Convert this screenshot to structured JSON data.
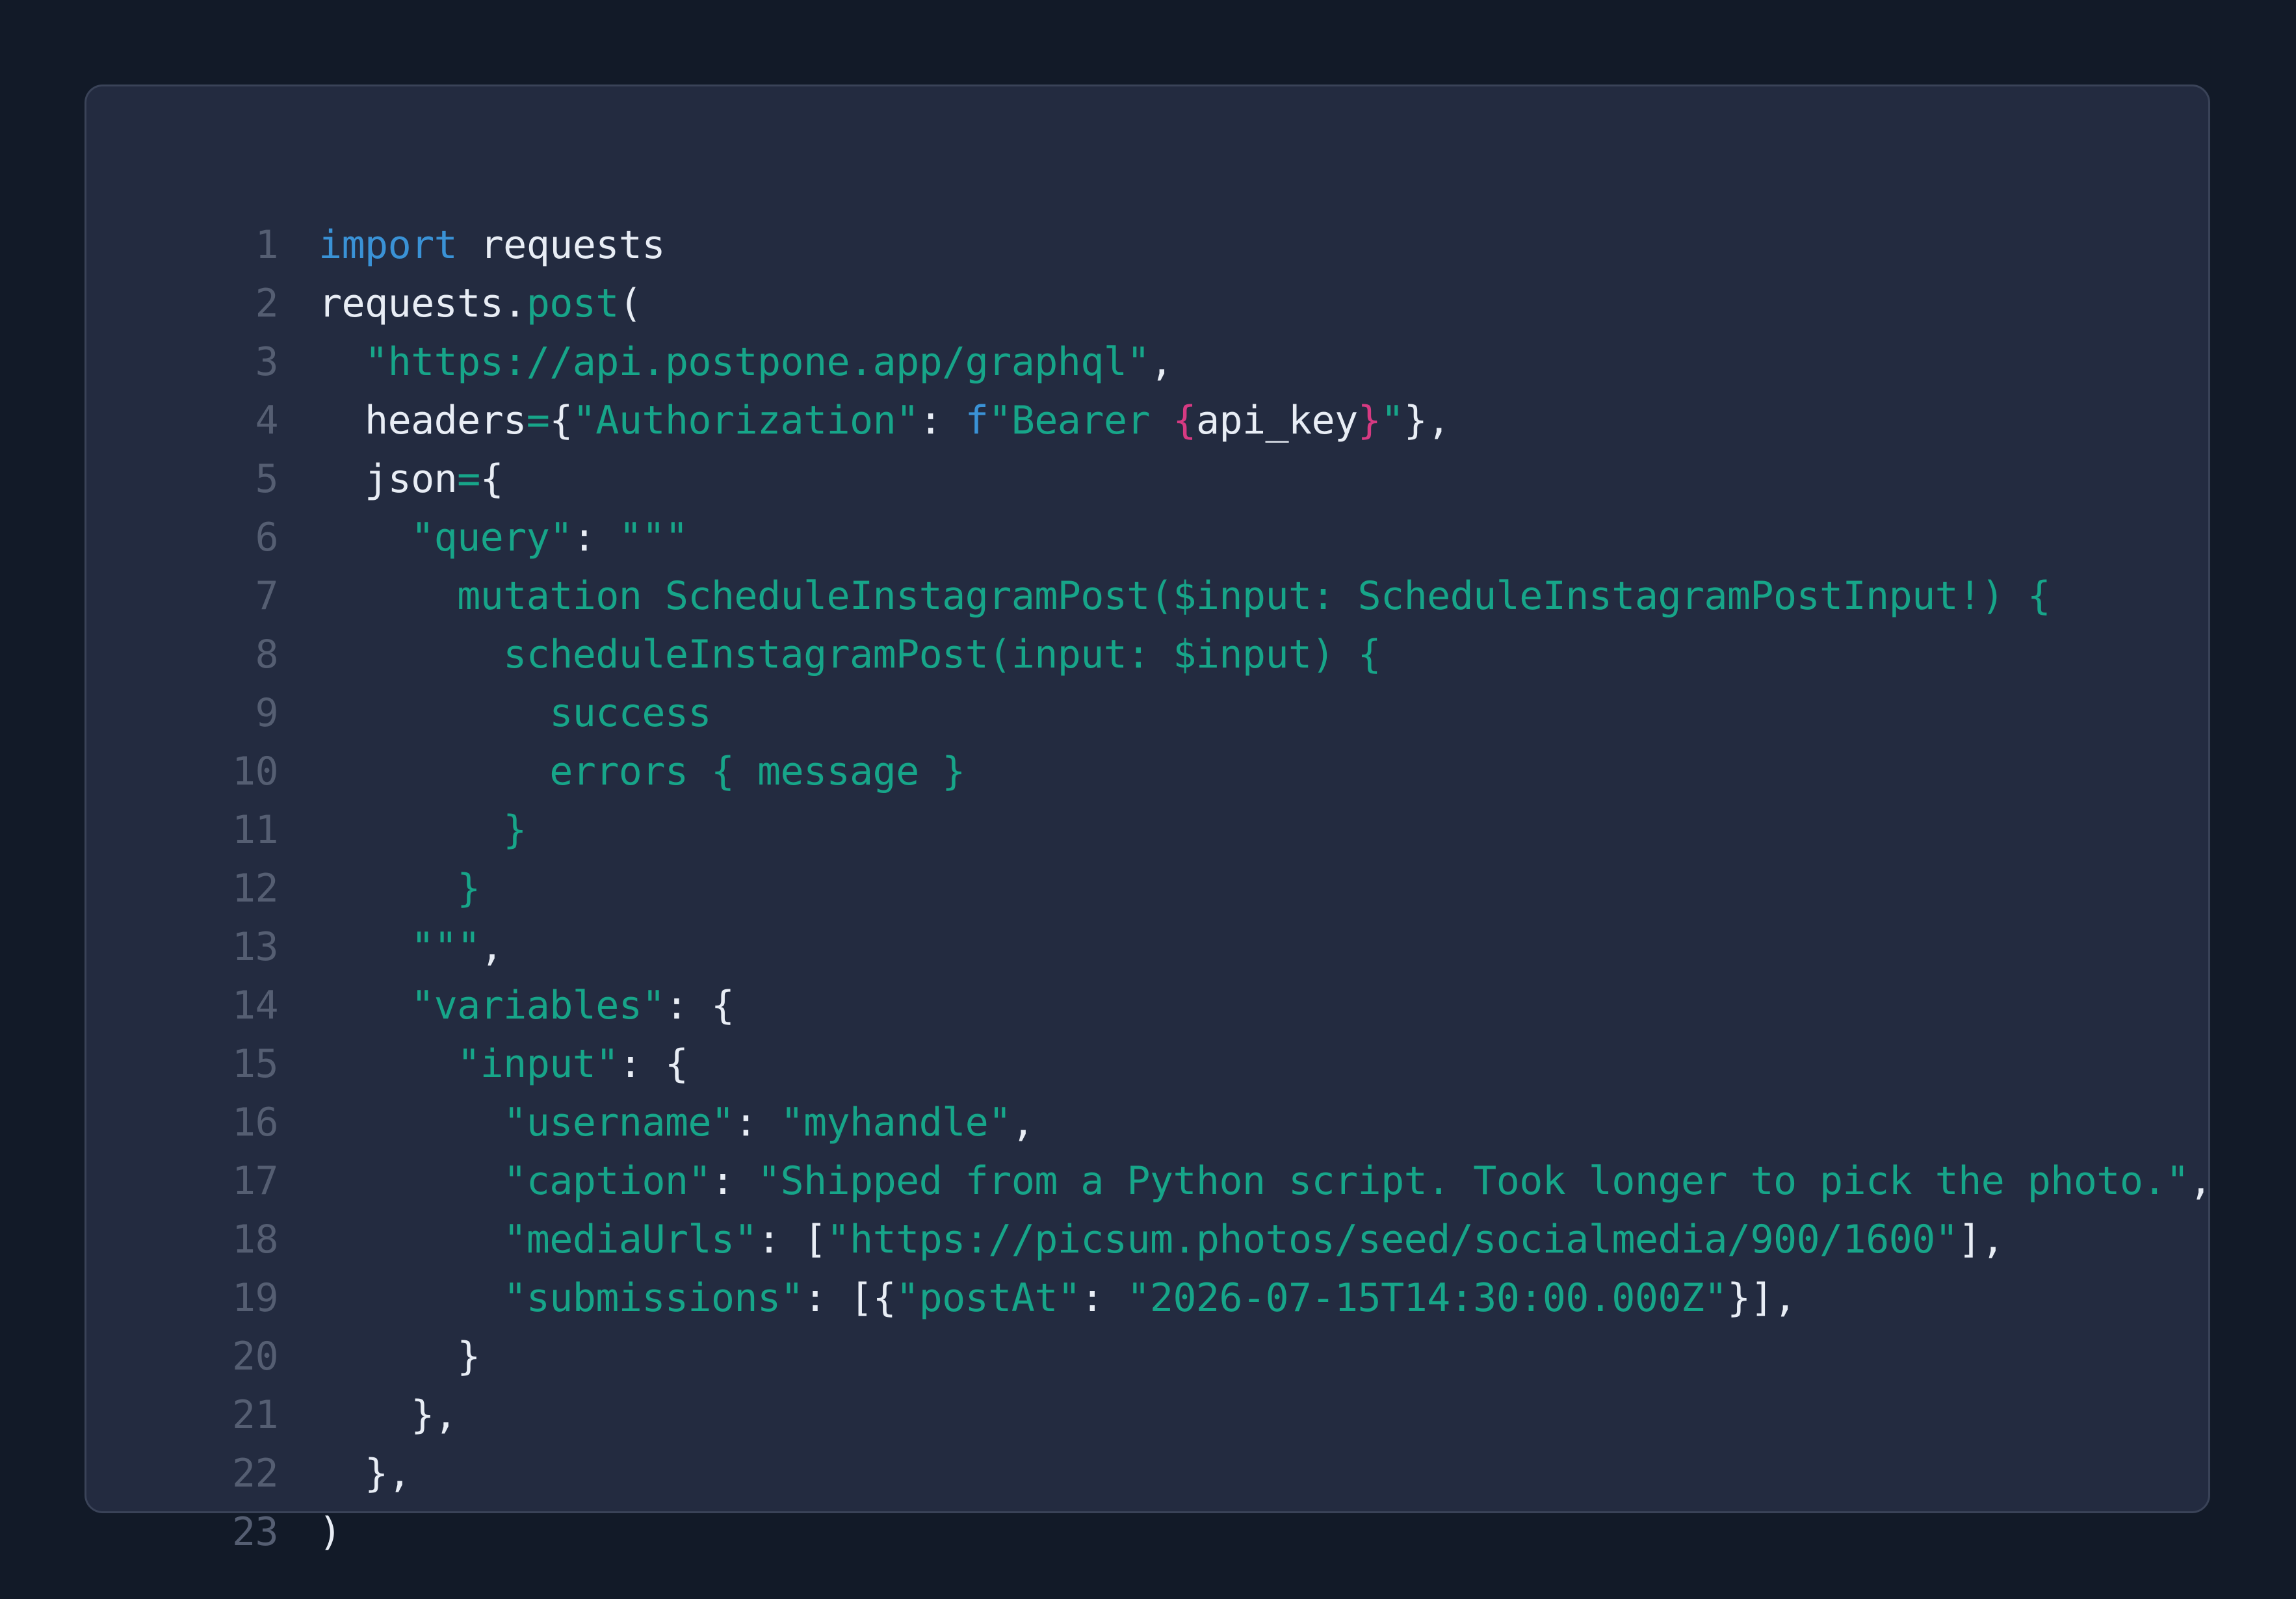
{
  "colors": {
    "background": "#121a28",
    "panel": "#232b40",
    "panel_border": "#3a4358",
    "line_number": "#555e72",
    "plain": "#e8edf5",
    "keyword": "#3a92d6",
    "function": "#17a589",
    "string": "#17a589",
    "interpolation_brace": "#d63a82"
  },
  "code": {
    "language": "python",
    "lines": [
      {
        "num": "1",
        "tokens": [
          {
            "t": "kw",
            "v": "import"
          },
          {
            "t": "plain",
            "v": " requests"
          }
        ]
      },
      {
        "num": "2",
        "tokens": [
          {
            "t": "plain",
            "v": "requests."
          },
          {
            "t": "fn",
            "v": "post"
          },
          {
            "t": "plain",
            "v": "("
          }
        ]
      },
      {
        "num": "3",
        "tokens": [
          {
            "t": "plain",
            "v": "  "
          },
          {
            "t": "str",
            "v": "\"https://api.postpone.app/graphql\""
          },
          {
            "t": "plain",
            "v": ","
          }
        ]
      },
      {
        "num": "4",
        "tokens": [
          {
            "t": "plain",
            "v": "  headers"
          },
          {
            "t": "op",
            "v": "="
          },
          {
            "t": "plain",
            "v": "{"
          },
          {
            "t": "str",
            "v": "\"Authorization\""
          },
          {
            "t": "plain",
            "v": ": "
          },
          {
            "t": "kw",
            "v": "f"
          },
          {
            "t": "str",
            "v": "\"Bearer "
          },
          {
            "t": "interp",
            "v": "{"
          },
          {
            "t": "plain",
            "v": "api_key"
          },
          {
            "t": "interp",
            "v": "}"
          },
          {
            "t": "str",
            "v": "\""
          },
          {
            "t": "plain",
            "v": "},"
          }
        ]
      },
      {
        "num": "5",
        "tokens": [
          {
            "t": "plain",
            "v": "  json"
          },
          {
            "t": "op",
            "v": "="
          },
          {
            "t": "plain",
            "v": "{"
          }
        ]
      },
      {
        "num": "6",
        "tokens": [
          {
            "t": "plain",
            "v": "    "
          },
          {
            "t": "str",
            "v": "\"query\""
          },
          {
            "t": "plain",
            "v": ": "
          },
          {
            "t": "str",
            "v": "\"\"\""
          }
        ]
      },
      {
        "num": "7",
        "tokens": [
          {
            "t": "str",
            "v": "      mutation ScheduleInstagramPost($input: ScheduleInstagramPostInput!) {"
          }
        ]
      },
      {
        "num": "8",
        "tokens": [
          {
            "t": "str",
            "v": "        scheduleInstagramPost(input: $input) {"
          }
        ]
      },
      {
        "num": "9",
        "tokens": [
          {
            "t": "str",
            "v": "          success"
          }
        ]
      },
      {
        "num": "10",
        "tokens": [
          {
            "t": "str",
            "v": "          errors { message }"
          }
        ]
      },
      {
        "num": "11",
        "tokens": [
          {
            "t": "str",
            "v": "        }"
          }
        ]
      },
      {
        "num": "12",
        "tokens": [
          {
            "t": "str",
            "v": "      }"
          }
        ]
      },
      {
        "num": "13",
        "tokens": [
          {
            "t": "str",
            "v": "    \"\"\""
          },
          {
            "t": "plain",
            "v": ","
          }
        ]
      },
      {
        "num": "14",
        "tokens": [
          {
            "t": "plain",
            "v": "    "
          },
          {
            "t": "str",
            "v": "\"variables\""
          },
          {
            "t": "plain",
            "v": ": {"
          }
        ]
      },
      {
        "num": "15",
        "tokens": [
          {
            "t": "plain",
            "v": "      "
          },
          {
            "t": "str",
            "v": "\"input\""
          },
          {
            "t": "plain",
            "v": ": {"
          }
        ]
      },
      {
        "num": "16",
        "tokens": [
          {
            "t": "plain",
            "v": "        "
          },
          {
            "t": "str",
            "v": "\"username\""
          },
          {
            "t": "plain",
            "v": ": "
          },
          {
            "t": "str",
            "v": "\"myhandle\""
          },
          {
            "t": "plain",
            "v": ","
          }
        ]
      },
      {
        "num": "17",
        "tokens": [
          {
            "t": "plain",
            "v": "        "
          },
          {
            "t": "str",
            "v": "\"caption\""
          },
          {
            "t": "plain",
            "v": ": "
          },
          {
            "t": "str",
            "v": "\"Shipped from a Python script. Took longer to pick the photo.\""
          },
          {
            "t": "plain",
            "v": ","
          }
        ]
      },
      {
        "num": "18",
        "tokens": [
          {
            "t": "plain",
            "v": "        "
          },
          {
            "t": "str",
            "v": "\"mediaUrls\""
          },
          {
            "t": "plain",
            "v": ": ["
          },
          {
            "t": "str",
            "v": "\"https://picsum.photos/seed/socialmedia/900/1600\""
          },
          {
            "t": "plain",
            "v": "],"
          }
        ]
      },
      {
        "num": "19",
        "tokens": [
          {
            "t": "plain",
            "v": "        "
          },
          {
            "t": "str",
            "v": "\"submissions\""
          },
          {
            "t": "plain",
            "v": ": [{"
          },
          {
            "t": "str",
            "v": "\"postAt\""
          },
          {
            "t": "plain",
            "v": ": "
          },
          {
            "t": "str",
            "v": "\"2026-07-15T14:30:00.000Z\""
          },
          {
            "t": "plain",
            "v": "}],"
          }
        ]
      },
      {
        "num": "20",
        "tokens": [
          {
            "t": "plain",
            "v": "      }"
          }
        ]
      },
      {
        "num": "21",
        "tokens": [
          {
            "t": "plain",
            "v": "    },"
          }
        ]
      },
      {
        "num": "22",
        "tokens": [
          {
            "t": "plain",
            "v": "  },"
          }
        ]
      },
      {
        "num": "23",
        "tokens": [
          {
            "t": "plain",
            "v": ")"
          }
        ]
      }
    ]
  }
}
